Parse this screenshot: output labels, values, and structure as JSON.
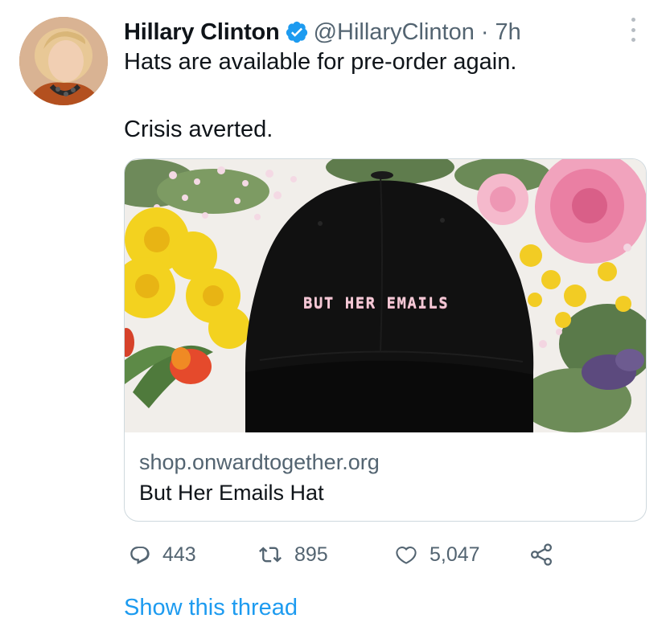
{
  "author": {
    "name": "Hillary Clinton",
    "handle": "@HillaryClinton",
    "separator": "·",
    "time": "7h",
    "verified_icon": "verified-badge-icon",
    "avatar": "avatar"
  },
  "tweet": {
    "line1": "Hats are available for pre-order again.",
    "line2": "Crisis averted."
  },
  "card": {
    "image_text": "BUT HER EMAILS",
    "domain": "shop.onwardtogether.org",
    "title": "But Her Emails Hat"
  },
  "actions": {
    "replies": "443",
    "retweets": "895",
    "likes": "5,047",
    "icons": [
      "reply-icon",
      "retweet-icon",
      "like-icon",
      "share-icon"
    ]
  },
  "show_thread": "Show this thread",
  "colors": {
    "text": "#0f1419",
    "secondary": "#536471",
    "accent": "#1d9bf0",
    "border": "#cfd9de"
  }
}
